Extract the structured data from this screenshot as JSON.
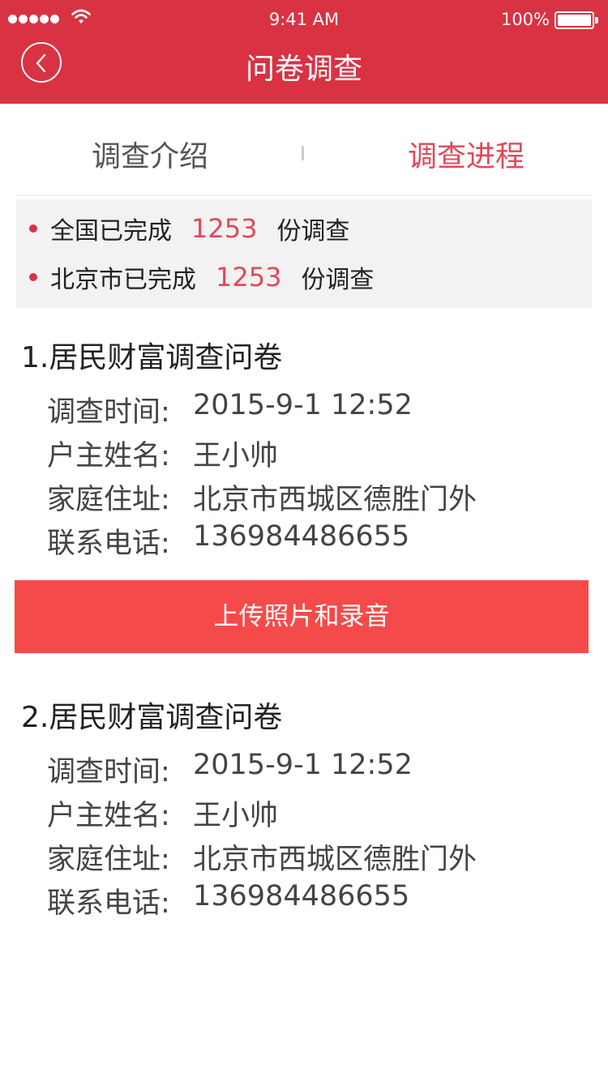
{
  "status_bar": {
    "time": "9:41 AM",
    "battery": "100%"
  },
  "nav": {
    "title": "问卷调查"
  },
  "tabs": [
    {
      "label": "调查介绍",
      "active": false
    },
    {
      "label": "调查进程",
      "active": true
    }
  ],
  "stats": [
    {
      "label": "全国已完成",
      "count": "1253",
      "suffix": "份调查"
    },
    {
      "label": "北京市已完成",
      "count": "1253",
      "suffix": "份调查"
    }
  ],
  "surveys": [
    {
      "title": "1.居民财富调查问卷",
      "fields": [
        {
          "label": "调查时间:",
          "value": "2015-9-1 12:52"
        },
        {
          "label": "户主姓名:",
          "value": "王小帅"
        },
        {
          "label": "家庭住址:",
          "value": "北京市西城区德胜门外"
        },
        {
          "label": "联系电话:",
          "value": "136984486655"
        }
      ]
    },
    {
      "title": "2.居民财富调查问卷",
      "fields": [
        {
          "label": "调查时间:",
          "value": "2015-9-1 12:52"
        },
        {
          "label": "户主姓名:",
          "value": "王小帅"
        },
        {
          "label": "家庭住址:",
          "value": "北京市西城区德胜门外"
        },
        {
          "label": "联系电话:",
          "value": "136984486655"
        }
      ]
    }
  ],
  "upload_button": "上传照片和录音",
  "colors": {
    "header": "#d93243",
    "accent": "#e0485a",
    "button": "#f54a4a",
    "stats_bg": "#f2f2f2"
  },
  "icons": [
    "signal-icon",
    "wifi-icon",
    "battery-icon",
    "back-arrow-icon"
  ]
}
